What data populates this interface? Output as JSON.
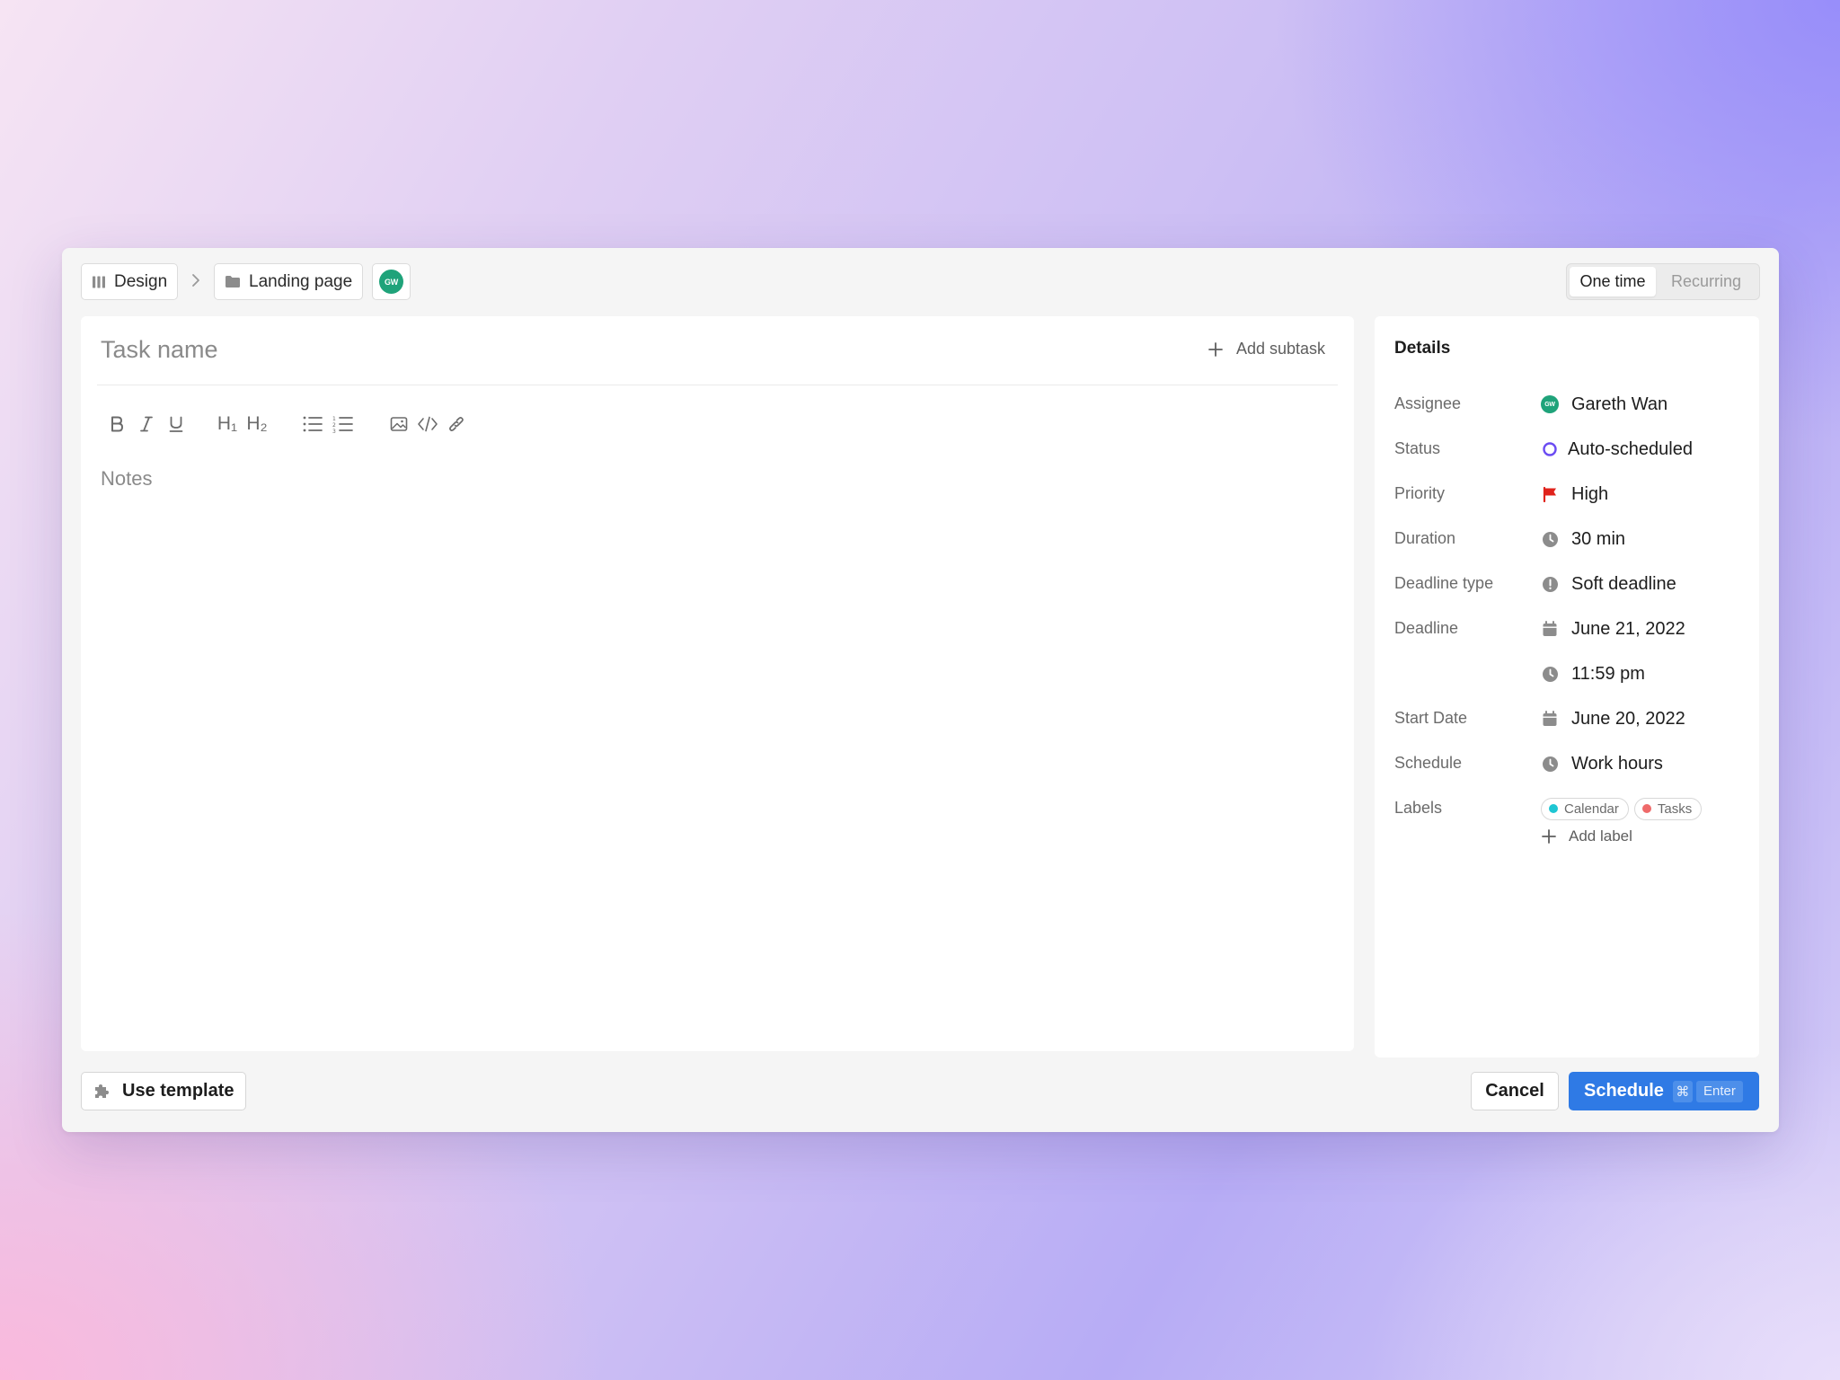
{
  "breadcrumb": {
    "workspace": "Design",
    "project": "Landing page",
    "assignee_initials": "GW"
  },
  "frequency": {
    "options": [
      "One time",
      "Recurring"
    ],
    "selected": "One time"
  },
  "editor": {
    "task_name_placeholder": "Task name",
    "add_subtask_label": "Add subtask",
    "toolbar": {
      "h1": "H₁",
      "h2": "H₂",
      "icons": [
        "bold-icon",
        "italic-icon",
        "underline-icon",
        "heading-1-icon",
        "heading-2-icon",
        "bullet-list-icon",
        "numbered-list-icon",
        "image-icon",
        "code-icon",
        "link-icon"
      ]
    },
    "notes_placeholder": "Notes"
  },
  "details": {
    "title": "Details",
    "assignee": {
      "label": "Assignee",
      "value": "Gareth Wan",
      "initials": "GW"
    },
    "status": {
      "label": "Status",
      "value": "Auto-scheduled",
      "color": "#6b4cf2"
    },
    "priority": {
      "label": "Priority",
      "value": "High",
      "color": "#e0231c"
    },
    "duration": {
      "label": "Duration",
      "value": "30 min"
    },
    "deadline_type": {
      "label": "Deadline type",
      "value": "Soft deadline"
    },
    "deadline": {
      "label": "Deadline",
      "date": "June 21, 2022",
      "time": "11:59 pm"
    },
    "start_date": {
      "label": "Start Date",
      "value": "June 20, 2022"
    },
    "schedule": {
      "label": "Schedule",
      "value": "Work hours"
    },
    "labels": {
      "label": "Labels",
      "items": [
        {
          "name": "Calendar",
          "color": "#1ec6d3"
        },
        {
          "name": "Tasks",
          "color": "#ef6a6a"
        }
      ],
      "add_label": "Add label"
    }
  },
  "footer": {
    "use_template": "Use template",
    "cancel": "Cancel",
    "schedule": "Schedule",
    "shortcut_cmd": "⌘",
    "shortcut_enter": "Enter"
  },
  "colors": {
    "primary": "#2f7ae5",
    "avatar": "#1fa37a"
  }
}
